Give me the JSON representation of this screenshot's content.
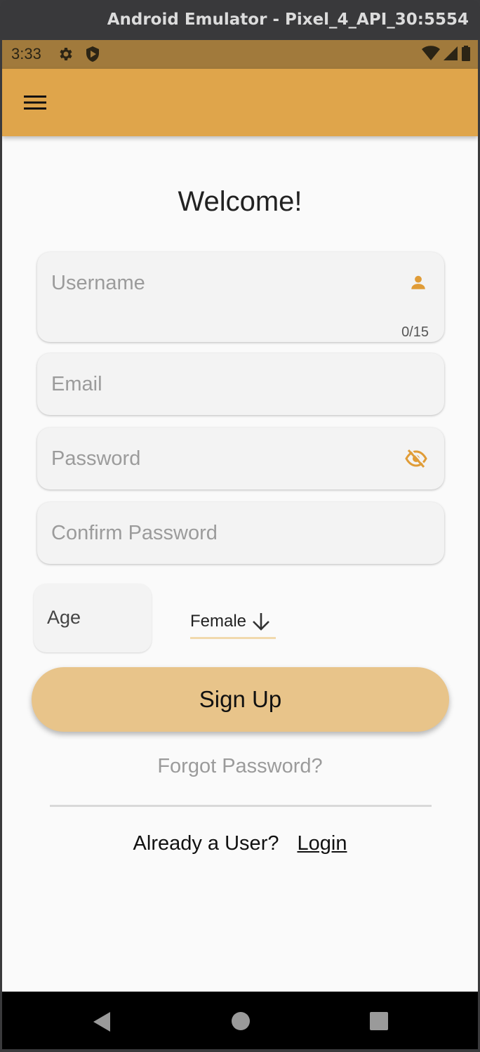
{
  "window": {
    "title": "Android Emulator - Pixel_4_API_30:5554"
  },
  "status_bar": {
    "time": "3:33"
  },
  "form": {
    "title": "Welcome!",
    "username": {
      "placeholder": "Username",
      "value": "",
      "counter": "0/15"
    },
    "email": {
      "placeholder": "Email",
      "value": ""
    },
    "password": {
      "placeholder": "Password",
      "value": ""
    },
    "confirm_password": {
      "placeholder": "Confirm Password",
      "value": ""
    },
    "age": {
      "placeholder": "Age",
      "value": ""
    },
    "gender": {
      "selected": "Female"
    },
    "signup_label": "Sign Up",
    "forgot_label": "Forgot Password?",
    "already_user_text": "Already a User?",
    "login_label": "Login"
  },
  "icons": {
    "menu": "menu-icon",
    "user": "person-icon",
    "visibility": "visibility-off-icon",
    "dropdown": "arrow-down-icon",
    "settings": "gear-icon",
    "security": "shield-icon",
    "wifi": "wifi-icon",
    "signal": "signal-icon",
    "battery": "battery-icon",
    "nav_back": "back-icon",
    "nav_home": "home-icon",
    "nav_recent": "recent-apps-icon"
  },
  "colors": {
    "app_bar": "#dfa54b",
    "status_bar": "#a17a3c",
    "accent": "#e09c37",
    "button": "#e8c48a"
  }
}
